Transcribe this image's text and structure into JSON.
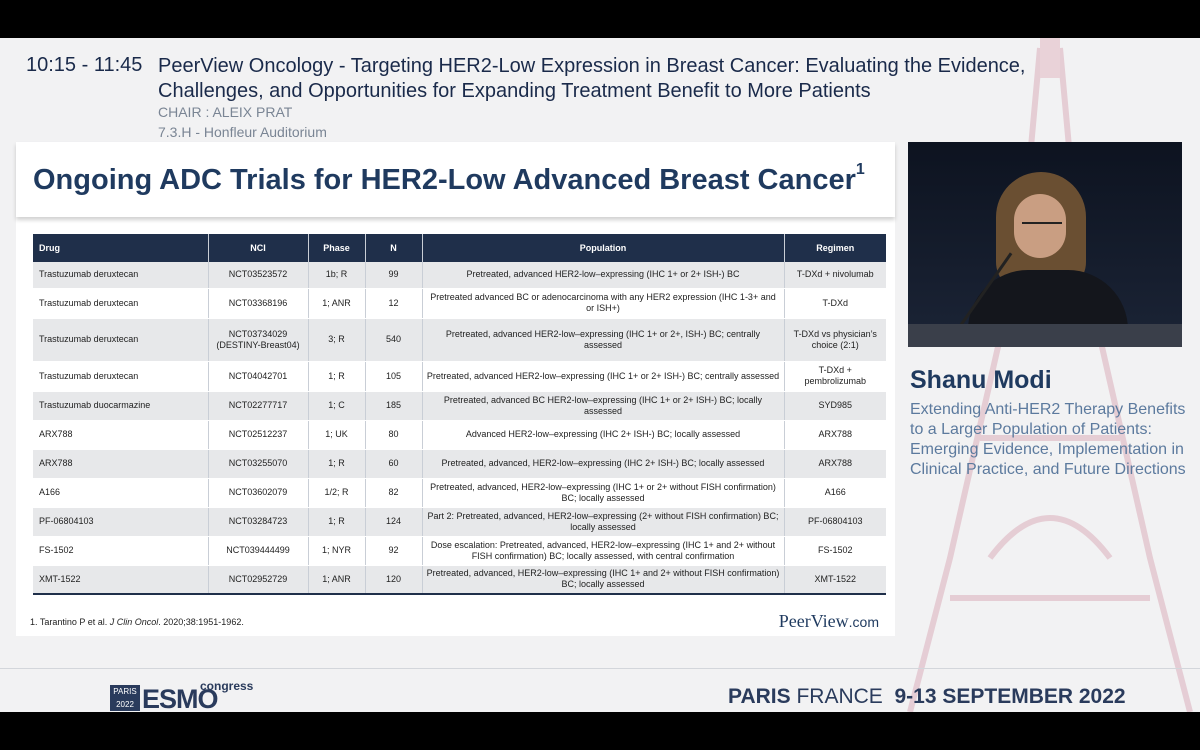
{
  "session": {
    "time": "10:15 - 11:45",
    "title": "PeerView Oncology - Targeting HER2-Low Expression in Breast Cancer: Evaluating the Evidence, Challenges, and Opportunities for Expanding Treatment Benefit to More Patients",
    "chair": "CHAIR : ALEIX PRAT",
    "room": "7.3.H - Honfleur Auditorium"
  },
  "slide": {
    "title": "Ongoing ADC Trials for HER2-Low Advanced Breast Cancer",
    "title_superscript": "1",
    "columns": [
      "Drug",
      "NCI",
      "Phase",
      "N",
      "Population",
      "Regimen"
    ],
    "rows": [
      {
        "drug": "Trastuzumab deruxtecan",
        "nci": "NCT03523572",
        "phase": "1b; R",
        "n": "99",
        "population": "Pretreated, advanced HER2-low–expressing (IHC 1+ or 2+ ISH-) BC",
        "regimen": "T-DXd + nivolumab"
      },
      {
        "drug": "Trastuzumab deruxtecan",
        "nci": "NCT03368196",
        "phase": "1; ANR",
        "n": "12",
        "population": "Pretreated advanced BC or adenocarcinoma with any HER2 expression (IHC 1-3+ and or ISH+)",
        "regimen": "T-DXd"
      },
      {
        "drug": "Trastuzumab deruxtecan",
        "nci": "NCT03734029 (DESTINY-Breast04)",
        "phase": "3; R",
        "n": "540",
        "population": "Pretreated, advanced HER2-low–expressing (IHC 1+ or 2+, ISH-) BC; centrally assessed",
        "regimen": "T-DXd vs physician’s choice (2:1)"
      },
      {
        "drug": "Trastuzumab deruxtecan",
        "nci": "NCT04042701",
        "phase": "1; R",
        "n": "105",
        "population": "Pretreated, advanced HER2-low–expressing (IHC 1+ or 2+ ISH-) BC; centrally assessed",
        "regimen": "T-DXd + pembrolizumab"
      },
      {
        "drug": "Trastuzumab duocarmazine",
        "nci": "NCT02277717",
        "phase": "1; C",
        "n": "185",
        "population": "Pretreated, advanced BC HER2-low–expressing (IHC 1+ or 2+ ISH-) BC; locally assessed",
        "regimen": "SYD985"
      },
      {
        "drug": "ARX788",
        "nci": "NCT02512237",
        "phase": "1; UK",
        "n": "80",
        "population": "Advanced HER2-low–expressing (IHC 2+ ISH-) BC; locally assessed",
        "regimen": "ARX788"
      },
      {
        "drug": "ARX788",
        "nci": "NCT03255070",
        "phase": "1; R",
        "n": "60",
        "population": "Pretreated, advanced, HER2-low–expressing (IHC 2+ ISH-) BC; locally assessed",
        "regimen": "ARX788"
      },
      {
        "drug": "A166",
        "nci": "NCT03602079",
        "phase": "1/2; R",
        "n": "82",
        "population": "Pretreated, advanced, HER2-low–expressing (IHC 1+ or 2+ without FISH confirmation) BC; locally assessed",
        "regimen": "A166"
      },
      {
        "drug": "PF-06804103",
        "nci": "NCT03284723",
        "phase": "1; R",
        "n": "124",
        "population": "Part 2: Pretreated, advanced, HER2-low–expressing (2+ without FISH confirmation) BC; locally assessed",
        "regimen": "PF-06804103"
      },
      {
        "drug": "FS-1502",
        "nci": "NCT039444499",
        "phase": "1; NYR",
        "n": "92",
        "population": "Dose escalation: Pretreated, advanced, HER2-low–expressing (IHC 1+ and 2+ without FISH confirmation) BC; locally assessed, with central confirmation",
        "regimen": "FS-1502"
      },
      {
        "drug": "XMT-1522",
        "nci": "NCT02952729",
        "phase": "1; ANR",
        "n": "120",
        "population": "Pretreated, advanced, HER2-low–expressing (IHC 1+ and 2+ without FISH confirmation) BC; locally assessed",
        "regimen": "XMT-1522"
      }
    ],
    "footnote_authors": "1. Tarantino P et al. ",
    "footnote_journal": "J Clin Oncol",
    "footnote_rest": ". 2020;38:1951-1962.",
    "brand": "PeerView",
    "brand_suffix": ".com"
  },
  "speaker": {
    "name": "Shanu Modi",
    "talk": "Extending Anti-HER2 Therapy Benefits to a Larger Population of Patients: Emerging Evidence, Implementation in Clinical Practice, and Future Directions"
  },
  "footer": {
    "logo_city": "PARIS",
    "logo_year": "2022",
    "logo_name": "ESMO",
    "logo_congress": "congress",
    "city": "PARIS",
    "country": "FRANCE",
    "dates": "9-13 SEPTEMBER 2022"
  },
  "colors": {
    "navy": "#1f3a5f",
    "table_header": "#1f2f4a",
    "muted_blue": "#5c7a9e",
    "background": "#f2f2f3"
  }
}
